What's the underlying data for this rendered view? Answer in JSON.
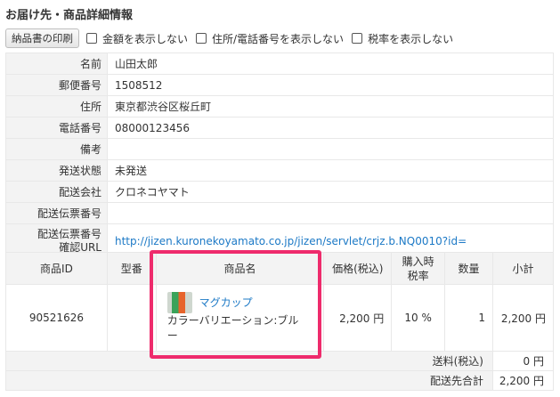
{
  "title": "お届け先・商品詳細情報",
  "toolbar": {
    "print_label": "納品書の印刷",
    "hide_amount": "金額を表示しない",
    "hide_address": "住所/電話番号を表示しない",
    "hide_tax": "税率を表示しない"
  },
  "info": [
    {
      "label": "名前",
      "value": "山田太郎"
    },
    {
      "label": "郵便番号",
      "value": "1508512"
    },
    {
      "label": "住所",
      "value": "東京都渋谷区桜丘町"
    },
    {
      "label": "電話番号",
      "value": "08000123456"
    },
    {
      "label": "備考",
      "value": ""
    },
    {
      "label": "発送状態",
      "value": "未発送"
    },
    {
      "label": "配送会社",
      "value": "クロネコヤマト"
    },
    {
      "label": "配送伝票番号",
      "value": ""
    }
  ],
  "tracking": {
    "label_line1": "配送伝票番号",
    "label_line2": "確認URL",
    "url": "http://jizen.kuronekoyamato.co.jp/jizen/servlet/crjz.b.NQ0010?id="
  },
  "items_header": {
    "id": "商品ID",
    "model": "型番",
    "name": "商品名",
    "price": "価格(税込)",
    "tax_line1": "購入時",
    "tax_line2": "税率",
    "qty": "数量",
    "subtotal": "小計"
  },
  "item": {
    "id": "90521626",
    "model": "",
    "name": "マグカップ",
    "variation_line1": "カラーバリエーション:ブル",
    "variation_line2": "ー",
    "price": "2,200 円",
    "tax": "10 %",
    "qty": "1",
    "subtotal": "2,200 円"
  },
  "totals": {
    "shipping_label": "送料(税込)",
    "shipping_value": "0 円",
    "total_label": "配送先合計",
    "total_value": "2,200 円"
  },
  "colors": {
    "link": "#1c79c6",
    "highlight": "#ee2b6c"
  }
}
